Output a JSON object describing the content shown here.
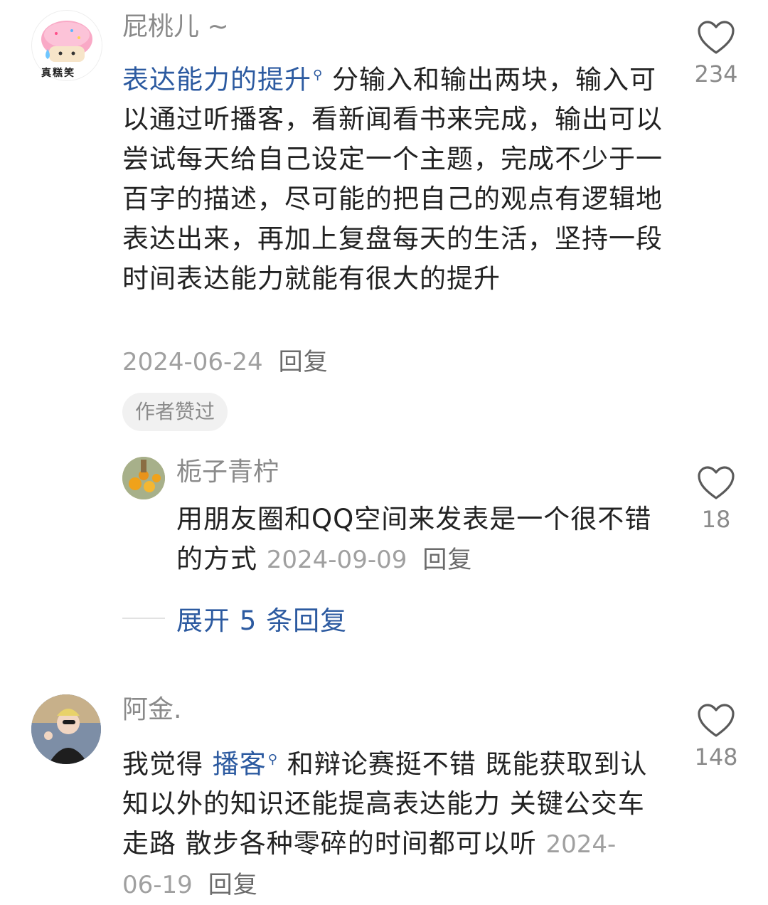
{
  "comments": [
    {
      "username": "屁桃儿 ~",
      "avatar_label": "真糕笑",
      "link_text": "表达能力的提升",
      "text": "分输入和输出两块，输入可以通过听播客，看新闻看书来完成，输出可以尝试每天给自己设定一个主题，完成不少于一百字的描述，尽可能的把自己的观点有逻辑地表达出来，再加上复盘每天的生活，坚持一段时间表达能力就能有很大的提升",
      "date": "2024-06-24",
      "reply_label": "回复",
      "likes": "234",
      "badge": "作者赞过"
    },
    {
      "username": "栀子青柠",
      "text": "用朋友圈和QQ空间来发表是一个很不错的方式",
      "date": "2024-09-09",
      "reply_label": "回复",
      "likes": "18"
    },
    {
      "username": "阿金.",
      "prefix_text": "我觉得",
      "link_text": "播客",
      "text": "和辩论赛挺不错 既能获取到认知以外的知识还能提高表达能力 关键公交车 走路 散步各种零碎的时间都可以听",
      "date": "2024-06-19",
      "reply_label": "回复",
      "likes": "148"
    }
  ],
  "expand_replies": "展开 5 条回复",
  "icons": {
    "like": "heart-outline-icon",
    "search_link": "search-link-icon"
  },
  "colors": {
    "link": "#2c5aa0",
    "meta": "#a0a0a0",
    "username": "#8a8a8a",
    "text": "#222222"
  }
}
